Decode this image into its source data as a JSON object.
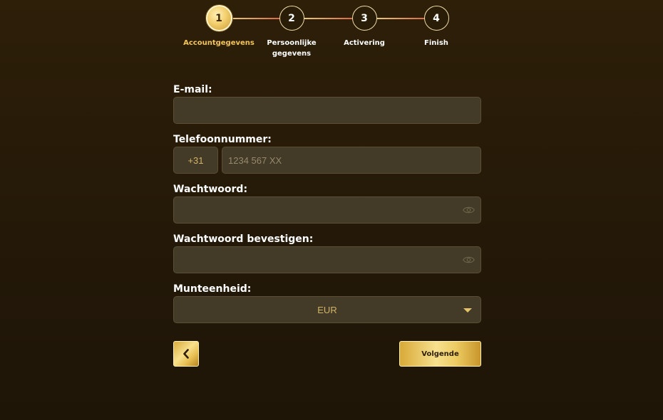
{
  "stepper": {
    "steps": [
      {
        "number": "1",
        "label": "Accountgegevens",
        "active": true
      },
      {
        "number": "2",
        "label": "Persoonlijke gegevens",
        "active": false
      },
      {
        "number": "3",
        "label": "Activering",
        "active": false
      },
      {
        "number": "4",
        "label": "Finish",
        "active": false
      }
    ]
  },
  "form": {
    "email": {
      "label": "E-mail:",
      "value": "",
      "placeholder": ""
    },
    "phone": {
      "label": "Telefoonnummer:",
      "prefix": "+31",
      "value": "",
      "placeholder": "1234 567 XX"
    },
    "password": {
      "label": "Wachtwoord:",
      "value": "",
      "placeholder": ""
    },
    "password_confirm": {
      "label": "Wachtwoord bevestigen:",
      "value": "",
      "placeholder": ""
    },
    "currency": {
      "label": "Munteenheid:",
      "selected": "EUR"
    }
  },
  "buttons": {
    "back_icon": "chevron-left-icon",
    "next_label": "Volgende"
  },
  "colors": {
    "background": "#2d1f08",
    "input_bg": "#433a27",
    "accent_gold": "#f3c55a",
    "connector": "#d96a3f"
  }
}
